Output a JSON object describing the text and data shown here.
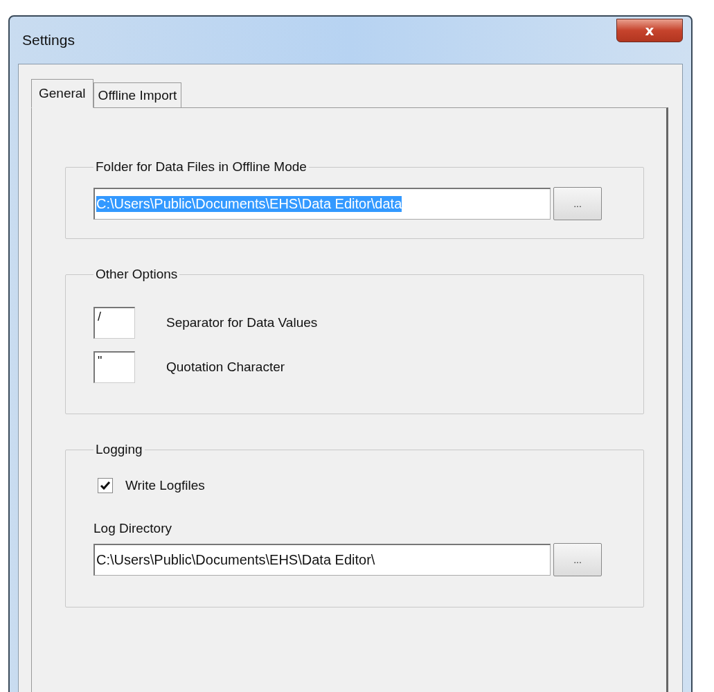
{
  "window": {
    "title": "Settings",
    "close_symbol": "x"
  },
  "tabs": [
    {
      "label": "General",
      "selected": true
    },
    {
      "label": "Offline Import",
      "selected": false
    }
  ],
  "groups": [
    {
      "kind": "path",
      "title": "Folder for Data Files in Offline Mode",
      "value": "C:\\Users\\Public\\Documents\\EHS\\Data Editor\\data",
      "text_selected": true,
      "browse": "..."
    },
    {
      "kind": "chars",
      "title": "Other Options",
      "rows": [
        {
          "value": "/",
          "label": "Separator for Data Values"
        },
        {
          "value": "\"",
          "label": "Quotation Character"
        }
      ]
    },
    {
      "kind": "logging",
      "title": "Logging",
      "checkbox": {
        "label": "Write Logfiles",
        "checked": true
      },
      "dir_label": "Log Directory",
      "value": "C:\\Users\\Public\\Documents\\EHS\\Data Editor\\",
      "text_selected": false,
      "browse": "..."
    }
  ]
}
